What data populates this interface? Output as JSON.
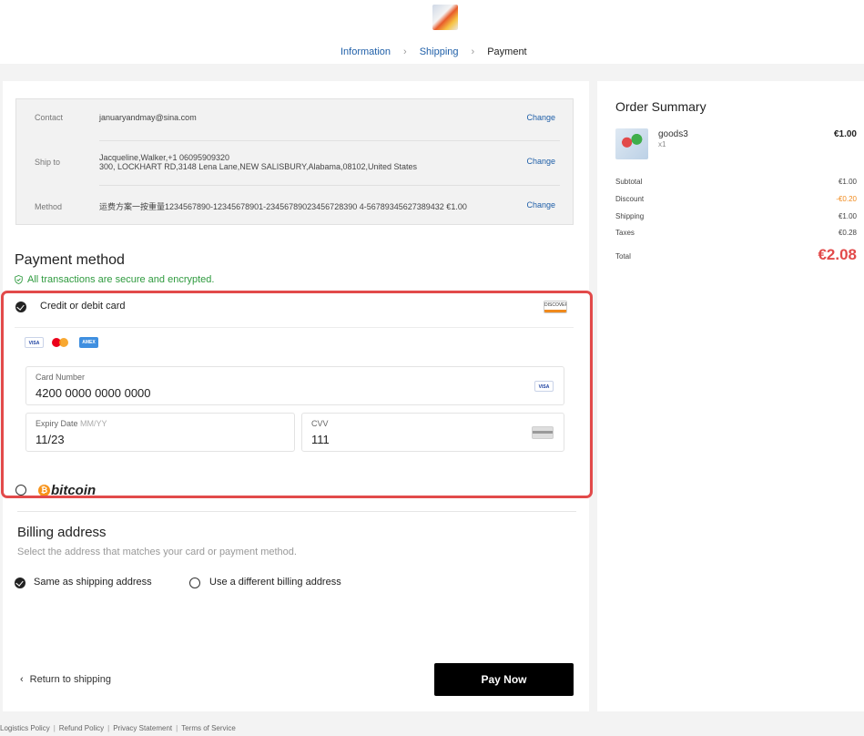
{
  "breadcrumb": {
    "information": "Information",
    "shipping": "Shipping",
    "payment": "Payment"
  },
  "info": {
    "contact_label": "Contact",
    "contact_value": "januaryandmay@sina.com",
    "shipto_label": "Ship to",
    "shipto_line1": "Jacqueline,Walker,+1 06095909320",
    "shipto_line2": "300, LOCKHART RD,3148 Lena Lane,NEW SALISBURY,Alabama,08102,United States",
    "method_label": "Method",
    "method_value": "运费方案一按重量1234567890-12345678901-23456789023456728390 4-56789345627389432 €1.00",
    "change": "Change"
  },
  "payment": {
    "title": "Payment method",
    "secure_text": "All transactions are secure and encrypted.",
    "card_option": "Credit or debit card",
    "discover_badge": "DISCOVER",
    "brands": {
      "visa": "VISA",
      "mastercard": "mastercard",
      "amex": "AMEX"
    },
    "card_number_label": "Card Number",
    "card_number_value": "4200 0000 0000 0000",
    "expiry_label": "Expiry Date",
    "expiry_hint": "MM/YY",
    "expiry_value": "11/23",
    "cvv_label": "CVV",
    "cvv_value": "111",
    "bitcoin_label": "bitcoin",
    "bitcoin_symbol": "₿"
  },
  "billing": {
    "title": "Billing address",
    "subtitle": "Select the address that matches your card or payment method.",
    "same_option": "Same as shipping address",
    "different_option": "Use a different billing address"
  },
  "actions": {
    "back": "Return to shipping",
    "pay_now": "Pay Now"
  },
  "footer": {
    "logistics": "Logistics Policy",
    "refund": "Refund Policy",
    "privacy": "Privacy Statement",
    "terms": "Terms of Service"
  },
  "summary": {
    "title": "Order Summary",
    "item_name": "goods3",
    "item_qty": "x1",
    "item_price": "€1.00",
    "subtotal_label": "Subtotal",
    "subtotal_value": "€1.00",
    "discount_label": "Discount",
    "discount_value": "-€0.20",
    "shipping_label": "Shipping",
    "shipping_value": "€1.00",
    "taxes_label": "Taxes",
    "taxes_value": "€0.28",
    "total_label": "Total",
    "total_value": "€2.08"
  },
  "colors": {
    "link": "#1f5fa8",
    "secure": "#2e9a3e",
    "total": "#e24a4a",
    "discount": "#f08a1d",
    "highlight": "#e24a4a"
  }
}
